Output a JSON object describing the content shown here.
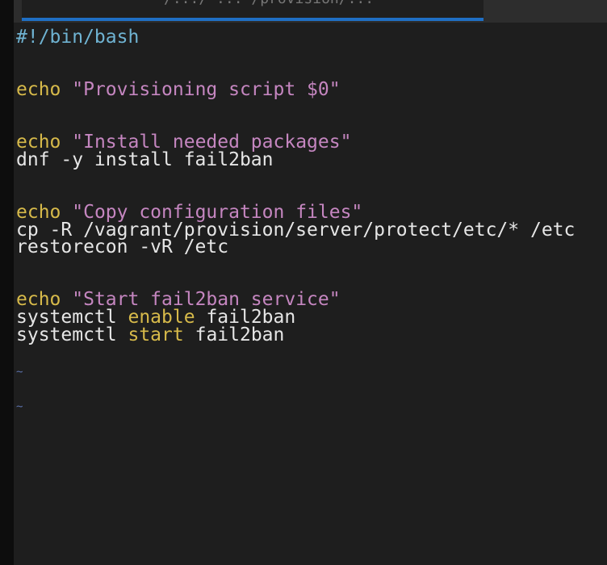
{
  "tab": {
    "title": "/.../ ... /provision/..."
  },
  "editor": {
    "shebang": "#!/bin/bash",
    "echo1_kw": "echo",
    "echo1_str": "\"Provisioning script $0\"",
    "echo2_kw": "echo",
    "echo2_str": "\"Install needed packages\"",
    "dnf_cmd": "dnf -y install fail2ban",
    "echo3_kw": "echo",
    "echo3_str": "\"Copy configuration files\"",
    "cp_cmd": "cp -R /vagrant/provision/server/protect/etc/* /etc",
    "restorecon_cmd": "restorecon -vR /etc",
    "echo4_kw": "echo",
    "echo4_str": "\"Start fail2ban service\"",
    "sys1_cmd": "systemctl",
    "sys1_kw": "enable",
    "sys1_arg": "fail2ban",
    "sys2_cmd": "systemctl",
    "sys2_kw": "start",
    "sys2_arg": "fail2ban",
    "tilde1": "~",
    "tilde2": "~"
  },
  "colors": {
    "background": "#1e1e1e",
    "keyword": "#d7ba4a",
    "string": "#c586c0",
    "shebang": "#6fb3d2",
    "tab_indicator": "#1f6fc4"
  }
}
